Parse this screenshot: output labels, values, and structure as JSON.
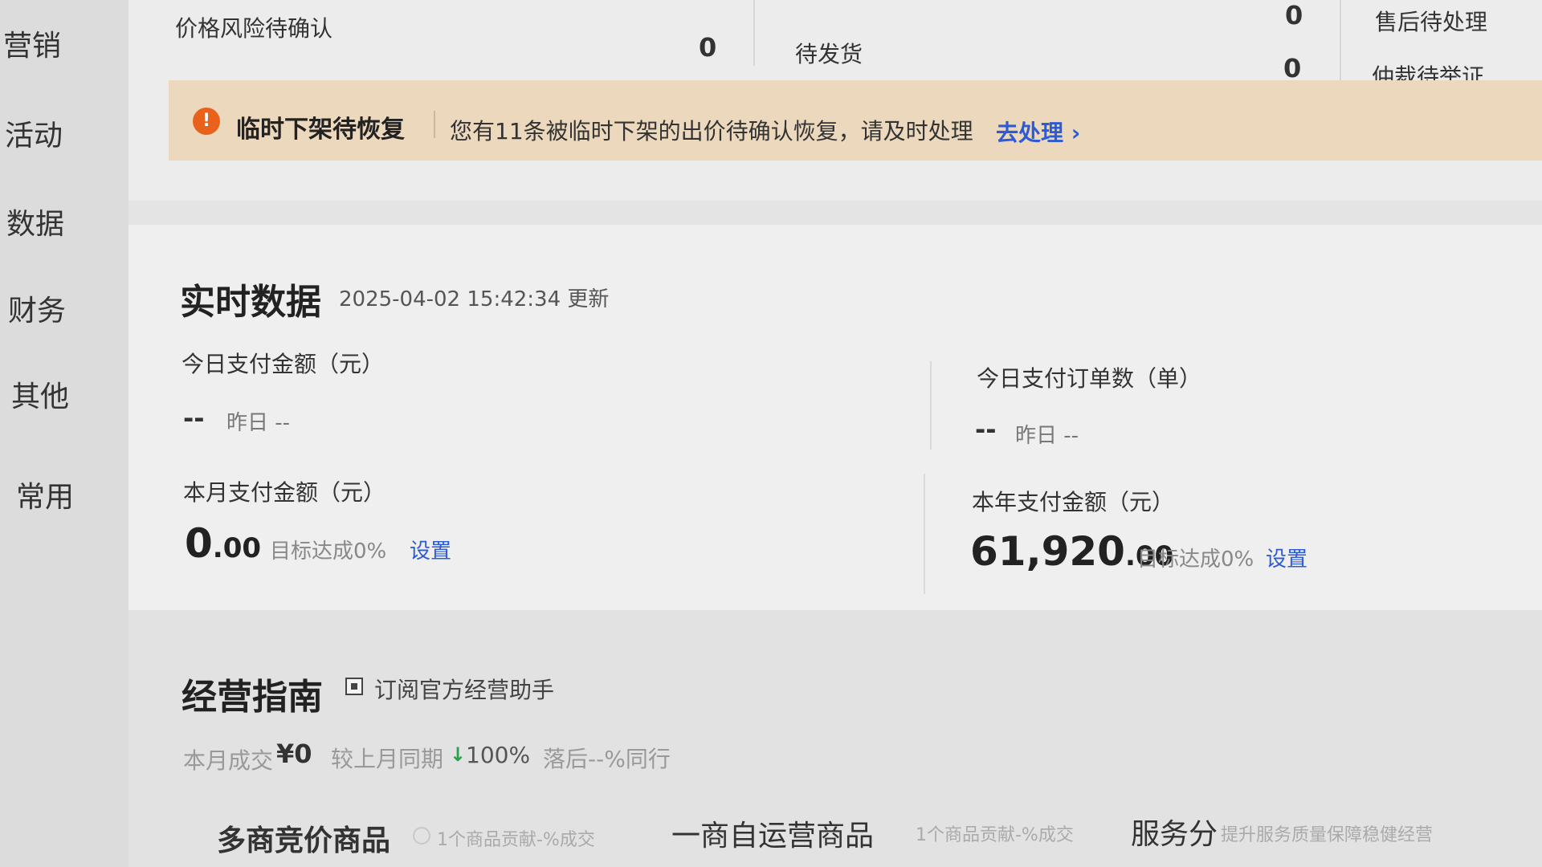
{
  "sidebar": {
    "items": [
      {
        "label": "营销"
      },
      {
        "label": "活动"
      },
      {
        "label": "数据"
      },
      {
        "label": "财务"
      },
      {
        "label": "其他"
      },
      {
        "label": "常用"
      }
    ]
  },
  "todo": {
    "price_risk": {
      "label": "价格风险待确认",
      "count": "0"
    },
    "pending_ship": {
      "label": "待发货"
    },
    "after_sales": {
      "label": "售后待处理",
      "count": "0"
    },
    "arbitration": {
      "label": "仲裁待举证",
      "count": "0"
    }
  },
  "alert": {
    "icon": "!",
    "title": "临时下架待恢复",
    "text": "您有11条被临时下架的出价待确认恢复，请及时处理",
    "link": "去处理 ›",
    "color": "#ecd8bd"
  },
  "realtime": {
    "title": "实时数据",
    "updated": "2025-04-02 15:42:34 更新",
    "today_amount": {
      "label": "今日支付金额（元）",
      "value": "--",
      "yesterday": "昨日 --"
    },
    "today_orders": {
      "label": "今日支付订单数（单）",
      "value": "--",
      "yesterday": "昨日 --"
    },
    "month_amount": {
      "label": "本月支付金额（元）",
      "int": "0",
      "dec": ".00",
      "goal": "目标达成0%",
      "set": "设置"
    },
    "year_amount": {
      "label": "本年支付金额（元）",
      "int": "61,920",
      "dec": ".00",
      "goal": "目标达成0%",
      "set": "设置"
    }
  },
  "guide": {
    "title": "经营指南",
    "subscribe": "订阅官方经营助手",
    "month_deal_label": "本月成交",
    "month_deal_value": "¥0",
    "compare_label": "较上月同期",
    "compare_value": "100%",
    "lag": "落后--%同行",
    "tabs": [
      {
        "title": "多商竞价商品",
        "hint": "1个商品贡献-%成交"
      },
      {
        "title": "一商自运营商品",
        "hint": "1个商品贡献-%成交"
      },
      {
        "title": "服务分",
        "hint": "提升服务质量保障稳健经营"
      }
    ]
  }
}
